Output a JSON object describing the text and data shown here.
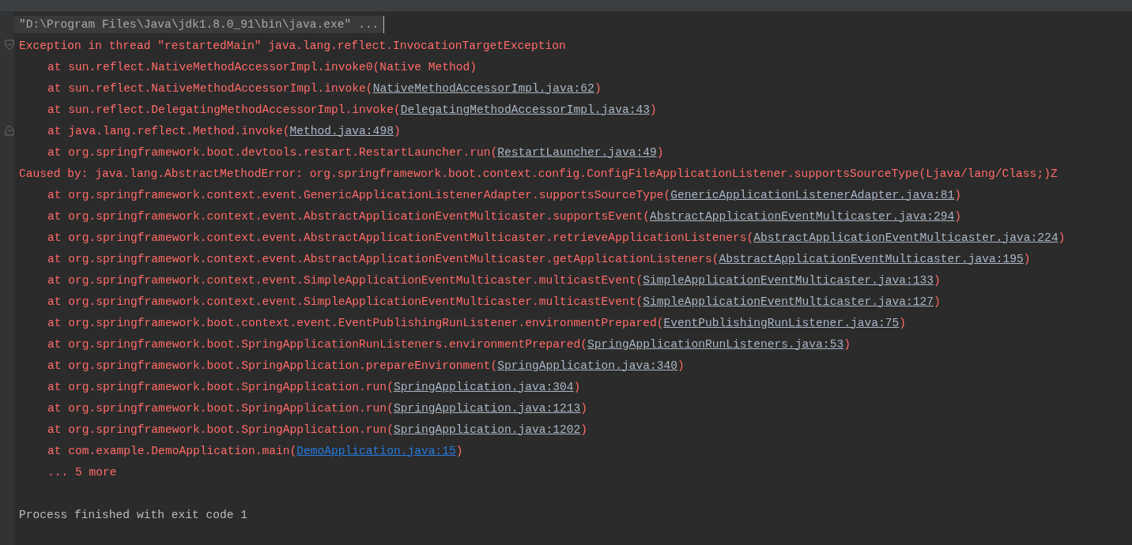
{
  "console": {
    "lines": [
      {
        "kind": "command",
        "text": "\"D:\\Program Files\\Java\\jdk1.8.0_91\\bin\\java.exe\" ...",
        "fold_start": false,
        "fold_end": false
      },
      {
        "kind": "error",
        "text": "Exception in thread \"restartedMain\" java.lang.reflect.InvocationTargetException",
        "fold_start": true,
        "fold_end": false
      },
      {
        "kind": "frame",
        "text": "at sun.reflect.NativeMethodAccessorImpl.invoke0(Native Method)",
        "fold_start": false,
        "fold_end": false
      },
      {
        "kind": "frame",
        "text": "at sun.reflect.NativeMethodAccessorImpl.invoke(",
        "link": "NativeMethodAccessorImpl.java:62",
        "tail": ")",
        "user_code": false,
        "fold_start": false,
        "fold_end": false
      },
      {
        "kind": "frame",
        "text": "at sun.reflect.DelegatingMethodAccessorImpl.invoke(",
        "link": "DelegatingMethodAccessorImpl.java:43",
        "tail": ")",
        "user_code": false,
        "fold_start": false,
        "fold_end": false
      },
      {
        "kind": "frame",
        "text": "at java.lang.reflect.Method.invoke(",
        "link": "Method.java:498",
        "tail": ")",
        "user_code": false,
        "fold_start": false,
        "fold_end": true
      },
      {
        "kind": "frame",
        "text": "at org.springframework.boot.devtools.restart.RestartLauncher.run(",
        "link": "RestartLauncher.java:49",
        "tail": ")",
        "user_code": false,
        "fold_start": false,
        "fold_end": false
      },
      {
        "kind": "error",
        "text": "Caused by: java.lang.AbstractMethodError: org.springframework.boot.context.config.ConfigFileApplicationListener.supportsSourceType(Ljava/lang/Class;)Z",
        "fold_start": false,
        "fold_end": false
      },
      {
        "kind": "frame",
        "text": "at org.springframework.context.event.GenericApplicationListenerAdapter.supportsSourceType(",
        "link": "GenericApplicationListenerAdapter.java:81",
        "tail": ")",
        "user_code": false,
        "fold_start": false,
        "fold_end": false
      },
      {
        "kind": "frame",
        "text": "at org.springframework.context.event.AbstractApplicationEventMulticaster.supportsEvent(",
        "link": "AbstractApplicationEventMulticaster.java:294",
        "tail": ")",
        "user_code": false,
        "fold_start": false,
        "fold_end": false
      },
      {
        "kind": "frame",
        "text": "at org.springframework.context.event.AbstractApplicationEventMulticaster.retrieveApplicationListeners(",
        "link": "AbstractApplicationEventMulticaster.java:224",
        "tail": ")",
        "user_code": false,
        "fold_start": false,
        "fold_end": false
      },
      {
        "kind": "frame",
        "text": "at org.springframework.context.event.AbstractApplicationEventMulticaster.getApplicationListeners(",
        "link": "AbstractApplicationEventMulticaster.java:195",
        "tail": ")",
        "user_code": false,
        "fold_start": false,
        "fold_end": false
      },
      {
        "kind": "frame",
        "text": "at org.springframework.context.event.SimpleApplicationEventMulticaster.multicastEvent(",
        "link": "SimpleApplicationEventMulticaster.java:133",
        "tail": ")",
        "user_code": false,
        "fold_start": false,
        "fold_end": false
      },
      {
        "kind": "frame",
        "text": "at org.springframework.context.event.SimpleApplicationEventMulticaster.multicastEvent(",
        "link": "SimpleApplicationEventMulticaster.java:127",
        "tail": ")",
        "user_code": false,
        "fold_start": false,
        "fold_end": false
      },
      {
        "kind": "frame",
        "text": "at org.springframework.boot.context.event.EventPublishingRunListener.environmentPrepared(",
        "link": "EventPublishingRunListener.java:75",
        "tail": ")",
        "user_code": false,
        "fold_start": false,
        "fold_end": false
      },
      {
        "kind": "frame",
        "text": "at org.springframework.boot.SpringApplicationRunListeners.environmentPrepared(",
        "link": "SpringApplicationRunListeners.java:53",
        "tail": ")",
        "user_code": false,
        "fold_start": false,
        "fold_end": false
      },
      {
        "kind": "frame",
        "text": "at org.springframework.boot.SpringApplication.prepareEnvironment(",
        "link": "SpringApplication.java:340",
        "tail": ")",
        "user_code": false,
        "fold_start": false,
        "fold_end": false
      },
      {
        "kind": "frame",
        "text": "at org.springframework.boot.SpringApplication.run(",
        "link": "SpringApplication.java:304",
        "tail": ")",
        "user_code": false,
        "fold_start": false,
        "fold_end": false
      },
      {
        "kind": "frame",
        "text": "at org.springframework.boot.SpringApplication.run(",
        "link": "SpringApplication.java:1213",
        "tail": ")",
        "user_code": false,
        "fold_start": false,
        "fold_end": false
      },
      {
        "kind": "frame",
        "text": "at org.springframework.boot.SpringApplication.run(",
        "link": "SpringApplication.java:1202",
        "tail": ")",
        "user_code": false,
        "fold_start": false,
        "fold_end": false
      },
      {
        "kind": "frame",
        "text": "at com.example.DemoApplication.main(",
        "link": "DemoApplication.java:15",
        "tail": ")",
        "user_code": true,
        "fold_start": false,
        "fold_end": false
      },
      {
        "kind": "frame",
        "text": "... 5 more",
        "fold_start": false,
        "fold_end": false
      },
      {
        "kind": "exit",
        "text": "Process finished with exit code 1",
        "fold_start": false,
        "fold_end": false
      }
    ]
  }
}
